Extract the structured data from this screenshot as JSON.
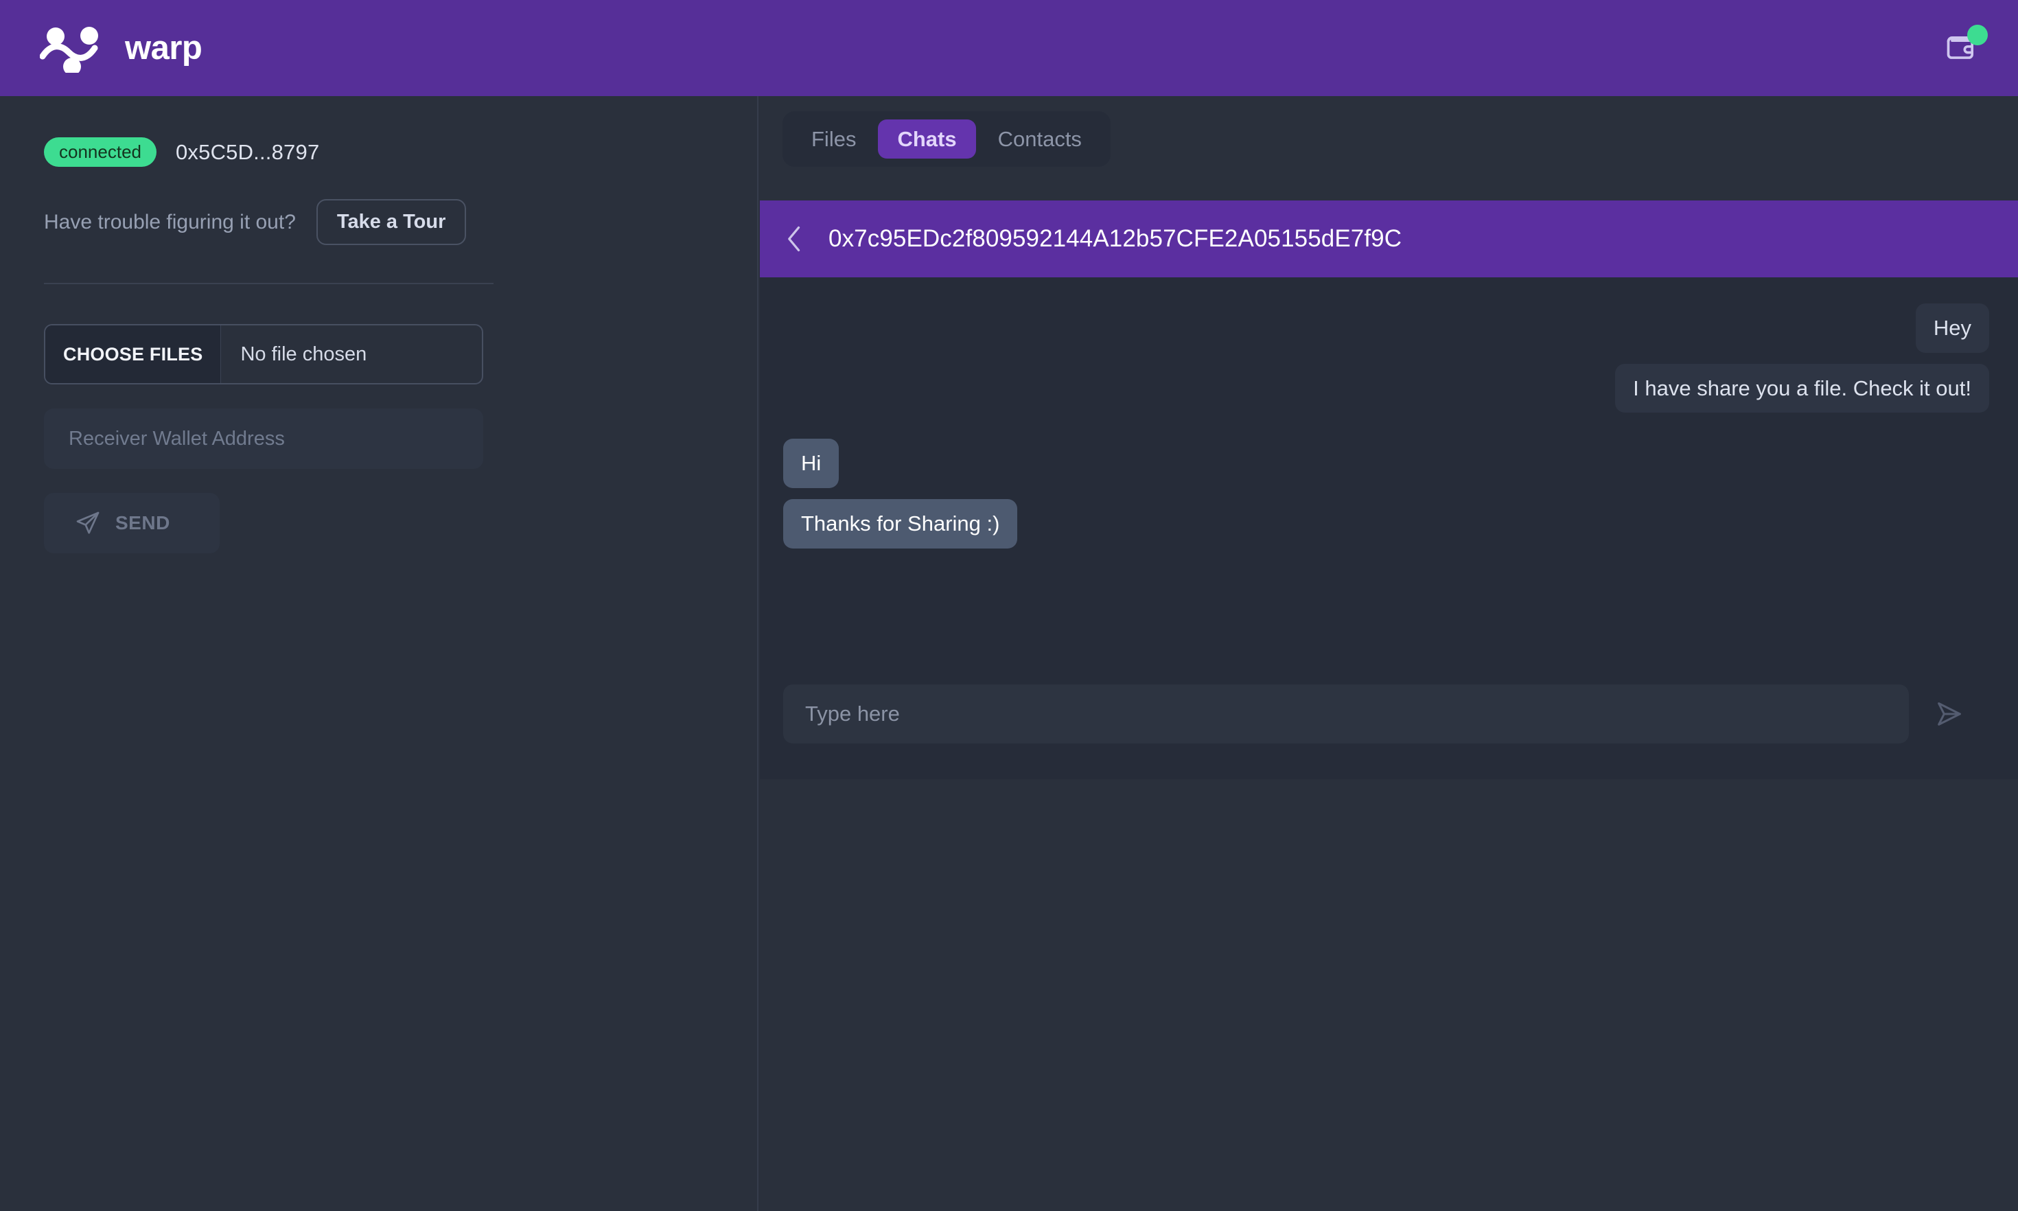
{
  "topbar": {
    "brand_name": "warp",
    "logo_icon": "warp-logo",
    "wallet_icon": "wallet-icon",
    "wallet_status_dot": "online-dot",
    "purple": "#562f98"
  },
  "sidebar": {
    "connection_status": "connected",
    "wallet_address": "0x5C5D...8797",
    "status_color": "#3ddc91",
    "tour_prompt": "Have trouble figuring it out?",
    "tour_button": "Take a Tour",
    "file_picker": {
      "button_label": "CHOOSE FILES",
      "file_status": "No file chosen"
    },
    "receiver_input": {
      "placeholder": "Receiver Wallet Address",
      "value": ""
    },
    "send_button": {
      "label": "SEND",
      "icon": "paper-plane-icon"
    }
  },
  "right_panel": {
    "tabs": [
      {
        "label": "Files",
        "active": false
      },
      {
        "label": "Chats",
        "active": true
      },
      {
        "label": "Contacts",
        "active": false
      }
    ],
    "chat": {
      "back_icon": "chevron-left-icon",
      "peer_address": "0x7c95EDc2f809592144A12b57CFE2A05155dE7f9C",
      "header_color": "#5b2fa0",
      "messages": [
        {
          "text": "Hey",
          "direction": "out"
        },
        {
          "text": "I have share you a file. Check it out!",
          "direction": "out"
        },
        {
          "text": "Hi",
          "direction": "in"
        },
        {
          "text": "Thanks for Sharing :)",
          "direction": "in"
        }
      ],
      "composer": {
        "placeholder": "Type here",
        "value": "",
        "send_icon": "send-icon"
      }
    }
  }
}
